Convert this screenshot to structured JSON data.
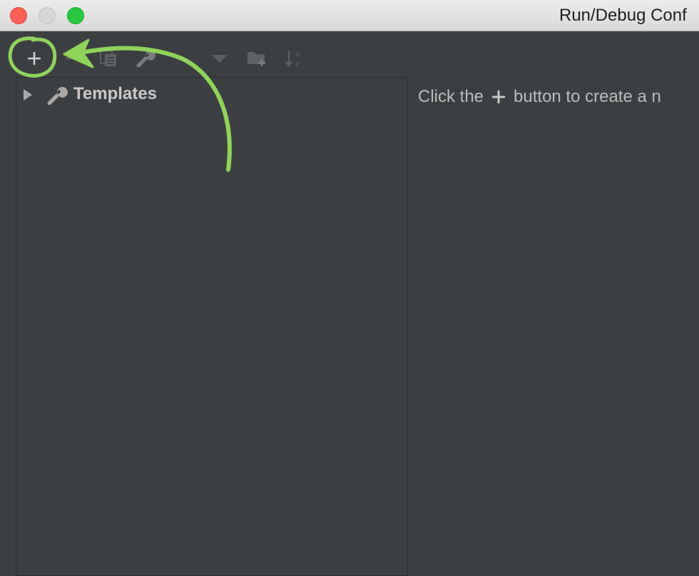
{
  "window": {
    "title": "Run/Debug Conf"
  },
  "toolbar": {
    "buttons": [
      {
        "name": "add-button",
        "icon": "plus-icon"
      },
      {
        "name": "remove-button",
        "icon": "minus-icon"
      },
      {
        "name": "copy-button",
        "icon": "copy-icon"
      },
      {
        "name": "edit-defaults-button",
        "icon": "wrench-icon"
      },
      {
        "name": "move-up-button",
        "icon": "arrow-up-icon"
      },
      {
        "name": "move-down-button",
        "icon": "triangle-down-icon"
      },
      {
        "name": "new-folder-button",
        "icon": "folder-add-icon"
      },
      {
        "name": "sort-button",
        "icon": "sort-alpha-icon"
      }
    ]
  },
  "tree": {
    "items": [
      {
        "label": "Templates",
        "icon": "wrench-icon",
        "expanded": false
      }
    ]
  },
  "hint": {
    "before": "Click the",
    "after": "button to create a n"
  },
  "colors": {
    "background": "#3c3f41",
    "annotation": "#8fd45a"
  }
}
